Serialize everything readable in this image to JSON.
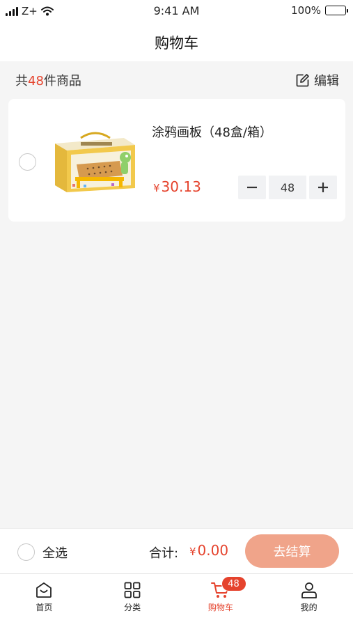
{
  "status_bar": {
    "carrier": "Z+",
    "time": "9:41 AM",
    "battery": "100%",
    "icons": [
      "signal-icon",
      "wifi-icon",
      "battery-icon"
    ]
  },
  "nav": {
    "title": "购物车"
  },
  "summary": {
    "prefix": "共",
    "count": "48",
    "suffix": "件商品",
    "edit_label": "编辑",
    "edit_icon": "edit-icon"
  },
  "cart_items": [
    {
      "name": "涂鸦画板（48盒/箱）",
      "currency": "¥",
      "price": "30.13",
      "quantity": "48",
      "image_icon": "product-image"
    }
  ],
  "checkout": {
    "select_all_label": "全选",
    "total_label": "合计:",
    "currency": "¥",
    "total_value": "0.00",
    "button_label": "去结算"
  },
  "tabs": [
    {
      "label": "首页",
      "icon": "home-icon"
    },
    {
      "label": "分类",
      "icon": "category-grid-icon"
    },
    {
      "label": "购物车",
      "icon": "cart-icon",
      "badge": "48",
      "active": true
    },
    {
      "label": "我的",
      "icon": "user-icon"
    }
  ],
  "colors": {
    "accent": "#e5432d",
    "checkout_button": "#f0a48a",
    "background": "#f5f5f5"
  }
}
